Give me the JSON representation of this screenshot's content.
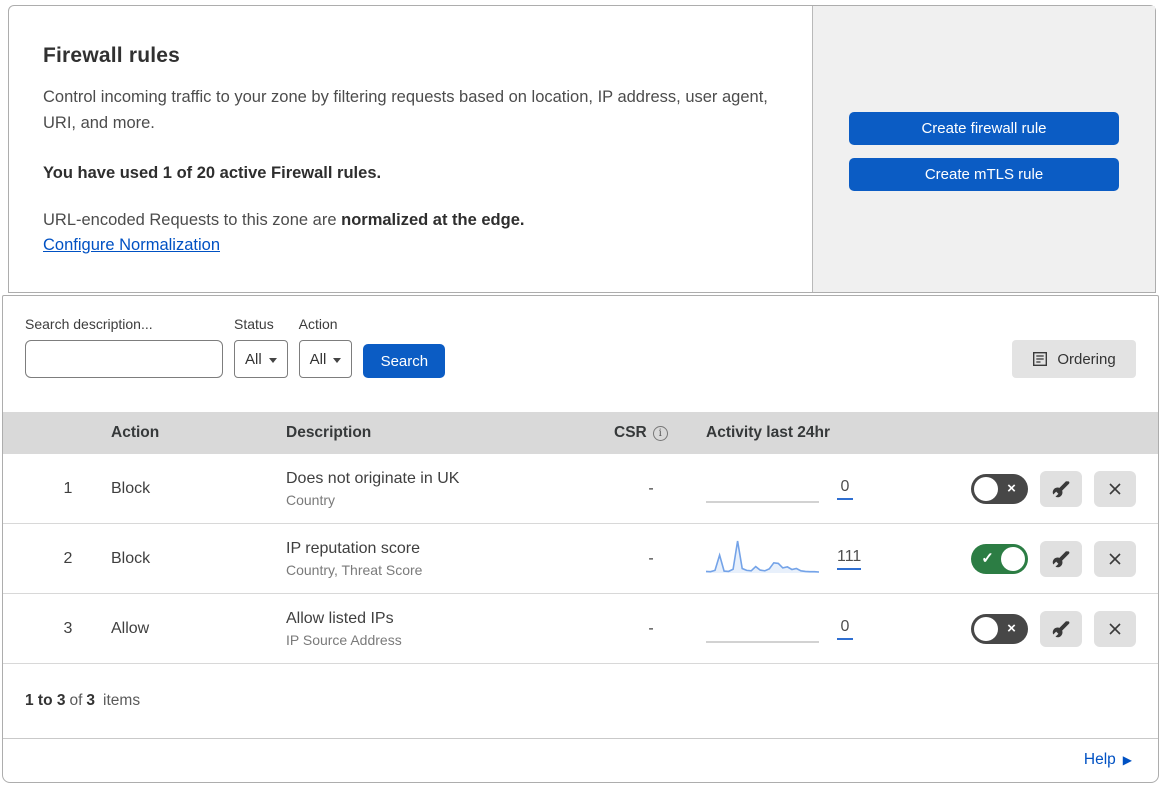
{
  "intro": {
    "title": "Firewall rules",
    "description": "Control incoming traffic to your zone by filtering requests based on location, IP address, user agent, URI, and more.",
    "usage": "You have used 1 of 20 active Firewall rules.",
    "normalization_text": "URL-encoded Requests to this zone are",
    "normalization_bold": "normalized at the edge.",
    "normalization_link": "Configure Normalization",
    "create_firewall_label": "Create firewall rule",
    "create_mtls_label": "Create mTLS rule"
  },
  "filters": {
    "search_label": "Search description...",
    "search_value": "",
    "status_label": "Status",
    "status_value": "All",
    "action_label": "Action",
    "action_value": "All",
    "search_button_label": "Search",
    "ordering_button_label": "Ordering"
  },
  "table": {
    "columns": {
      "action": "Action",
      "description": "Description",
      "csr": "CSR",
      "activity": "Activity last 24hr"
    },
    "rows": [
      {
        "priority": "1",
        "action": "Block",
        "description": "Does not originate in UK",
        "fields": "Country",
        "csr": "-",
        "activity_count": "0",
        "enabled": false
      },
      {
        "priority": "2",
        "action": "Block",
        "description": "IP reputation score",
        "fields": "Country, Threat Score",
        "csr": "-",
        "activity_count": "111",
        "enabled": true
      },
      {
        "priority": "3",
        "action": "Allow",
        "description": "Allow listed IPs",
        "fields": "IP Source Address",
        "csr": "-",
        "activity_count": "0",
        "enabled": false
      }
    ],
    "sparkline_points": [
      5,
      4,
      8,
      56,
      6,
      5,
      12,
      100,
      14,
      8,
      7,
      20,
      9,
      7,
      13,
      32,
      30,
      16,
      19,
      11,
      14,
      7,
      5,
      4,
      4,
      3
    ],
    "toggle_on_mark": "✓",
    "toggle_off_mark": "×"
  },
  "footer": {
    "range": "1 to 3",
    "of_label": "of",
    "total": "3",
    "items_label": "items",
    "help_label": "Help",
    "help_arrow": "▶"
  },
  "colors": {
    "accent_blue": "#0b5cc4",
    "link_blue": "#0051c3",
    "toggle_on_green": "#2c7d44",
    "toggle_off_gray": "#474747",
    "sparkline_blue": "#74a3e8",
    "sparkline_fill": "#e8f0fb",
    "header_row_gray": "#d9d9d9",
    "side_panel_gray": "#f0f0f0"
  }
}
